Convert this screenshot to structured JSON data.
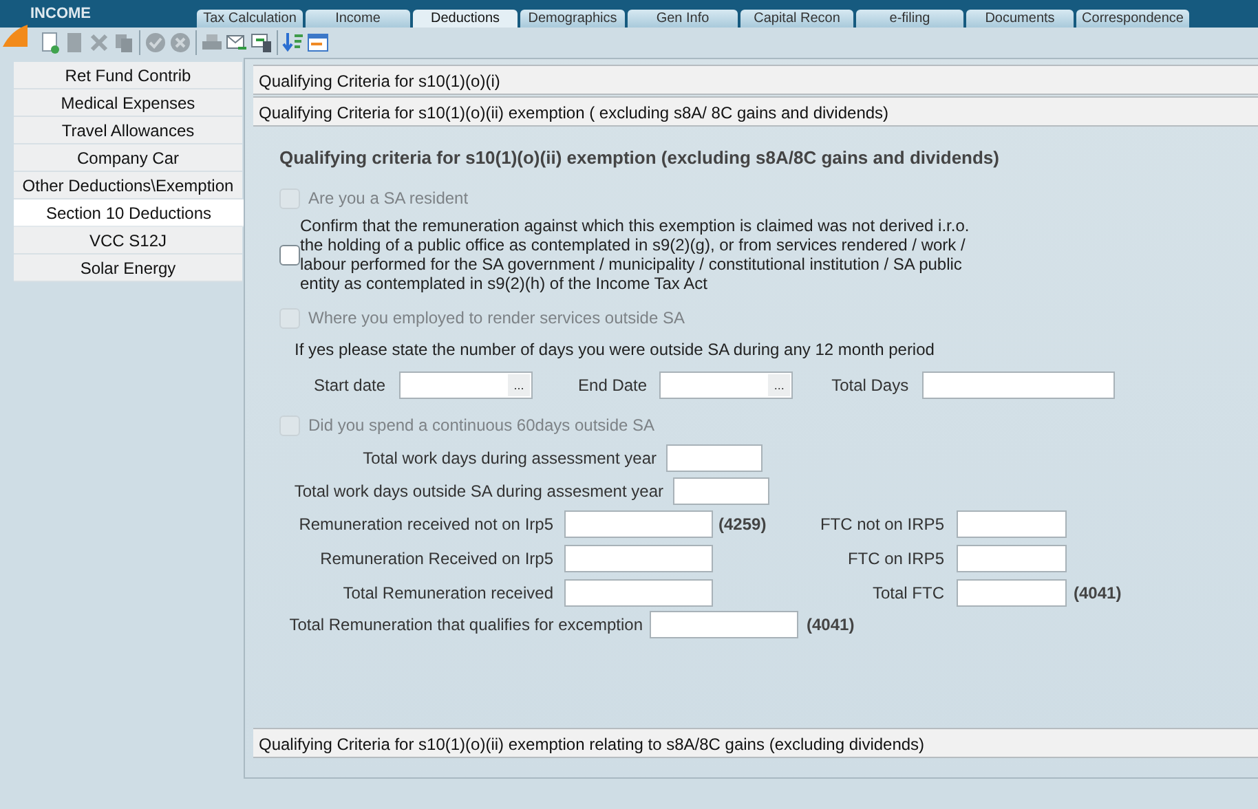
{
  "app_title": "INCOME",
  "tabs": [
    {
      "label": "Tax Calculation",
      "selected": false
    },
    {
      "label": "Income",
      "selected": false
    },
    {
      "label": "Deductions",
      "selected": true
    },
    {
      "label": "Demographics",
      "selected": false
    },
    {
      "label": "Gen Info",
      "selected": false
    },
    {
      "label": "Capital Recon",
      "selected": false
    },
    {
      "label": "e-filing",
      "selected": false
    },
    {
      "label": "Documents",
      "selected": false
    },
    {
      "label": "Correspondence",
      "selected": false
    }
  ],
  "sidebar": {
    "items": [
      {
        "label": "Ret Fund Contrib",
        "selected": false
      },
      {
        "label": "Medical Expenses",
        "selected": false
      },
      {
        "label": "Travel Allowances",
        "selected": false
      },
      {
        "label": "Company Car",
        "selected": false
      },
      {
        "label": "Other Deductions\\Exemption",
        "selected": false
      },
      {
        "label": "Section 10  Deductions",
        "selected": true
      },
      {
        "label": "VCC S12J",
        "selected": false
      },
      {
        "label": "Solar Energy",
        "selected": false
      }
    ]
  },
  "sections": [
    {
      "title": "Qualifying Criteria for s10(1)(o)(i)"
    },
    {
      "title": "Qualifying Criteria for s10(1)(o)(ii) exemption (  excluding s8A/ 8C gains and dividends)"
    }
  ],
  "form": {
    "heading": "Qualifying criteria for s10(1)(o)(ii) exemption (excluding s8A/8C gains and dividends)",
    "checks": [
      {
        "label": "Are you a SA resident",
        "checked": false,
        "disabled": true
      },
      {
        "label": "Confirm that the remuneration against which this exemption is claimed was not derived i.r.o. the holding of a public office as contemplated in s9(2)(g), or from services rendered / work / labour performed for the SA government / municipality / constitutional institution / SA public entity as contemplated in s9(2)(h) of the Income Tax Act",
        "checked": false,
        "disabled": false
      },
      {
        "label": "Where you employed to render services outside SA",
        "checked": false,
        "disabled": true
      }
    ],
    "hint": "If yes please state the number of days you were outside SA  during any 12 month period",
    "dates": [
      {
        "label": "Start date",
        "button": "..."
      },
      {
        "label": "End Date",
        "button": "..."
      }
    ],
    "total_days": {
      "label": "Total Days"
    },
    "continuous": {
      "label": "Did you spend a continuous 60days outside SA",
      "checked": false,
      "disabled": true
    },
    "work_days": [
      {
        "label": "Total work days during assessment year"
      },
      {
        "label": "Total work days outside SA during assesment year"
      }
    ],
    "remuneration_rows": [
      {
        "label": "Remuneration received not on Irp5",
        "code": "(4259)",
        "ftc_label": "FTC not on IRP5"
      },
      {
        "label": "Remuneration Received on Irp5",
        "ftc_label": "FTC on IRP5"
      },
      {
        "label": "Total Remuneration received",
        "ftc_label": "Total FTC",
        "ftc_code": "(4041)"
      }
    ],
    "qualifying": {
      "label": "Total Remuneration that qualifies for excemption",
      "code": "(4041)"
    }
  },
  "bottom_section": {
    "title": "Qualifying Criteria for s10(1)(o)(ii) exemption relating to s8A/8C gains (excluding dividends)"
  }
}
